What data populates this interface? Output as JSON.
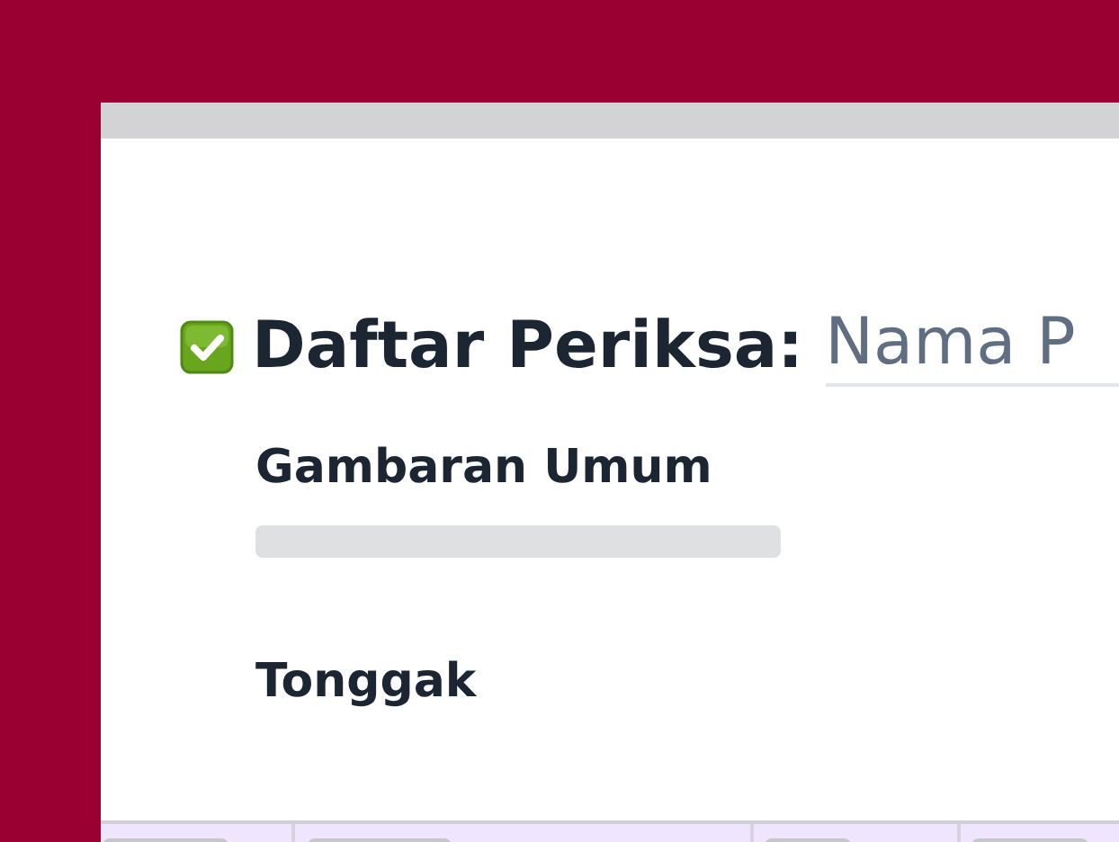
{
  "header": {
    "title": "Daftar Periksa:",
    "name_field": {
      "value": "Nama P"
    }
  },
  "overview": {
    "heading": "Gambaran Umum",
    "body": {
      "kind": "skeleton"
    }
  },
  "milestones": {
    "heading": "Tonggak"
  },
  "table": {
    "columns": [
      {
        "kind": "skeleton"
      },
      {
        "kind": "skeleton"
      },
      {
        "kind": "skeleton"
      },
      {
        "kind": "skeleton"
      }
    ]
  }
}
